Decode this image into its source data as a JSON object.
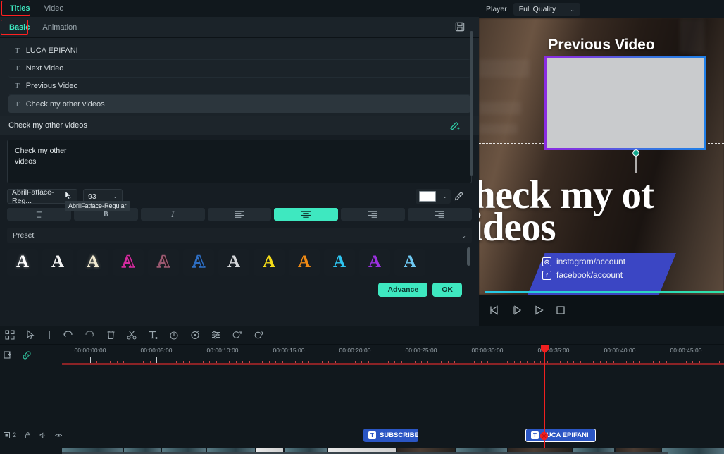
{
  "top_tabs": [
    {
      "label": "Titles",
      "active": true,
      "highlight": true
    },
    {
      "label": "Video",
      "active": false,
      "highlight": false
    }
  ],
  "sub_tabs": [
    {
      "label": "Basic",
      "active": true,
      "highlight": true
    },
    {
      "label": "Animation",
      "active": false,
      "highlight": false
    }
  ],
  "save_icon": "save-icon",
  "title_list": [
    {
      "label": "LUCA EPIFANI",
      "selected": false
    },
    {
      "label": "Next Video",
      "selected": false
    },
    {
      "label": "Previous Video",
      "selected": false
    },
    {
      "label": "Check my other  videos",
      "selected": true
    }
  ],
  "name_row": {
    "value": "Check my other  videos",
    "ai_icon": "ai-magic-wand-icon"
  },
  "text_editor": {
    "line1": "Check my other",
    "line2": "videos"
  },
  "font_controls": {
    "font_family": "AbrilFatface-Reg...",
    "font_size": "93",
    "tooltip": "AbrilFatface-Regular",
    "color_hex": "#ffffff",
    "eyedropper_icon": "eyedropper-icon"
  },
  "format_buttons": [
    {
      "name": "text-style-button",
      "glyph": "⛏",
      "active": false
    },
    {
      "name": "bold-button",
      "glyph": "B",
      "active": false
    },
    {
      "name": "italic-button",
      "glyph": "I",
      "active": false
    },
    {
      "name": "align-left-button",
      "glyph": "▤",
      "active": false
    },
    {
      "name": "align-center-button",
      "glyph": "▤",
      "active": true
    },
    {
      "name": "align-right-button",
      "glyph": "▤",
      "active": false
    },
    {
      "name": "align-justify-button",
      "glyph": "▤",
      "active": false
    }
  ],
  "preset": {
    "label": "Preset",
    "swatches": [
      {
        "name": "preset-white-solid",
        "color": "#ffffff",
        "style": "solid"
      },
      {
        "name": "preset-white-plain",
        "color": "#f2f2f2",
        "style": "solid"
      },
      {
        "name": "preset-cream",
        "color": "#f2ead0",
        "style": "solid"
      },
      {
        "name": "preset-magenta-outline",
        "color": "#d52ba0",
        "style": "outline"
      },
      {
        "name": "preset-rose-outline",
        "color": "#9c5a72",
        "style": "outline"
      },
      {
        "name": "preset-blue-outline",
        "color": "#2e6fc4",
        "style": "outline"
      },
      {
        "name": "preset-silver",
        "color": "#d5d7da",
        "style": "solid"
      },
      {
        "name": "preset-yellow",
        "color": "#f5dc18",
        "style": "solid"
      },
      {
        "name": "preset-orange",
        "color": "#f08a14",
        "style": "solid"
      },
      {
        "name": "preset-cyan",
        "color": "#2ec4f0",
        "style": "solid"
      },
      {
        "name": "preset-purple",
        "color": "#9b30e0",
        "style": "solid"
      },
      {
        "name": "preset-lightblue",
        "color": "#6ec8f2",
        "style": "solid"
      }
    ]
  },
  "actions": {
    "advance": "Advance",
    "ok": "OK"
  },
  "preview": {
    "player_label": "Player",
    "quality": "Full Quality",
    "overlay_title": "Previous Video",
    "big_text_line1": "heck my ot",
    "big_text_line2": "ideos",
    "social": [
      {
        "icon": "instagram-icon",
        "glyph": "◉",
        "label": "instagram/account"
      },
      {
        "icon": "facebook-icon",
        "glyph": "f",
        "label": "facebook/account"
      }
    ],
    "controls": [
      {
        "name": "prev-frame-button",
        "glyph": "◁|"
      },
      {
        "name": "next-frame-button",
        "glyph": "|▷"
      },
      {
        "name": "play-button",
        "glyph": "▷"
      },
      {
        "name": "stop-button",
        "glyph": "□"
      }
    ]
  },
  "timeline": {
    "toolbar": [
      {
        "name": "crop-tool-icon",
        "glyph": "⛶"
      },
      {
        "name": "pointer-tool-icon",
        "glyph": "➤"
      },
      {
        "name": "marker-tool-icon",
        "glyph": "|"
      },
      {
        "name": "undo-icon",
        "glyph": "↩"
      },
      {
        "name": "redo-icon",
        "glyph": "↪"
      },
      {
        "name": "delete-icon",
        "glyph": "🗑"
      },
      {
        "name": "split-scissors-icon",
        "glyph": "✂"
      },
      {
        "name": "text-tool-icon",
        "glyph": "T"
      },
      {
        "name": "speed-timer-icon",
        "glyph": "⏱"
      },
      {
        "name": "color-tool-icon",
        "glyph": "◌"
      },
      {
        "name": "audio-mixer-icon",
        "glyph": "≡"
      },
      {
        "name": "keyframe-icon",
        "glyph": "⚲"
      },
      {
        "name": "audio-detach-icon",
        "glyph": "⚯"
      }
    ],
    "left_controls": [
      {
        "name": "add-marker-icon",
        "glyph": "▣"
      },
      {
        "name": "link-icon",
        "glyph": "⛓"
      }
    ],
    "ruler_labels": [
      "00:00:00:00",
      "00:00:05:00",
      "00:00:10:00",
      "00:00:15:00",
      "00:00:20:00",
      "00:00:25:00",
      "00:00:30:00",
      "00:00:35:00",
      "00:00:40:00",
      "00:00:45:00"
    ],
    "playhead_position": "00:00:35:00",
    "track_header": {
      "track_number": "2",
      "icons": [
        {
          "name": "track-lock-icon",
          "glyph": "🔒"
        },
        {
          "name": "track-mute-icon",
          "glyph": "🔈"
        },
        {
          "name": "track-visibility-icon",
          "glyph": "👁"
        }
      ]
    },
    "clips": [
      {
        "name": "clip-subscribe",
        "label": "SUBSCRIBE",
        "badge": "T",
        "selected": false
      },
      {
        "name": "clip-luca-epifani",
        "label": "LUCA EPIFANI",
        "badge": "T",
        "selected": true
      }
    ]
  }
}
